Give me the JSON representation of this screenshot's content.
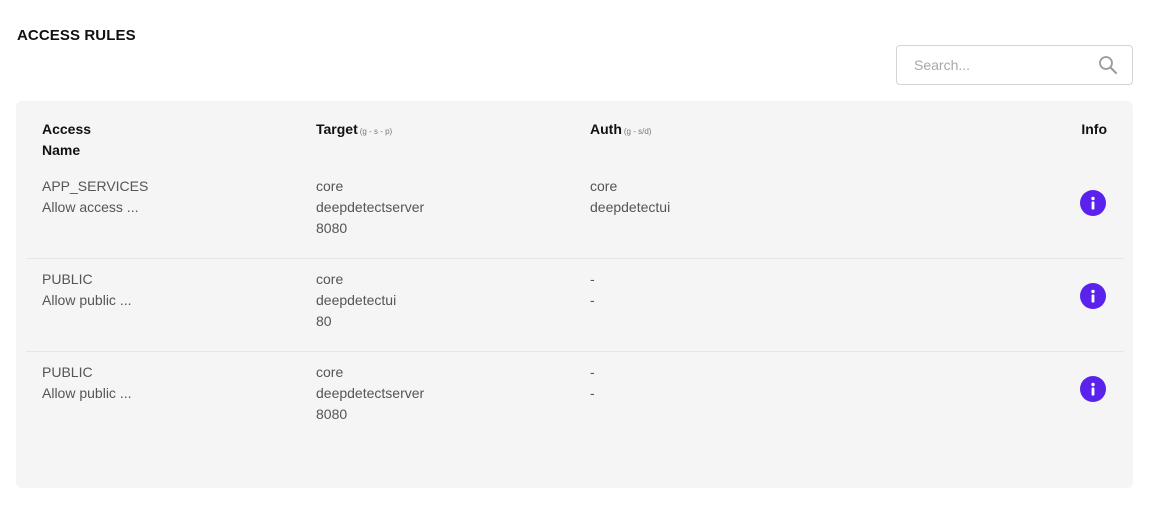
{
  "page": {
    "title": "ACCESS RULES"
  },
  "search": {
    "placeholder": "Search...",
    "value": ""
  },
  "table": {
    "headers": {
      "name_line1": "Access",
      "name_line2": "Name",
      "target": "Target",
      "target_hint": "(g - s - p)",
      "auth": "Auth",
      "auth_hint": "(g - s/d)",
      "info": "Info"
    },
    "rows": [
      {
        "name": "APP_SERVICES",
        "description": "Allow access ...",
        "target": [
          "core",
          "deepdetectserver",
          "8080"
        ],
        "auth": [
          "core",
          "deepdetectui"
        ]
      },
      {
        "name": "PUBLIC",
        "description": "Allow public ...",
        "target": [
          "core",
          "deepdetectui",
          "80"
        ],
        "auth": [
          "-",
          "-"
        ]
      },
      {
        "name": "PUBLIC",
        "description": "Allow public ...",
        "target": [
          "core",
          "deepdetectserver",
          "8080"
        ],
        "auth": [
          "-",
          "-"
        ]
      }
    ]
  },
  "colors": {
    "accent": "#5b22ee",
    "card_bg": "#f5f5f5"
  }
}
